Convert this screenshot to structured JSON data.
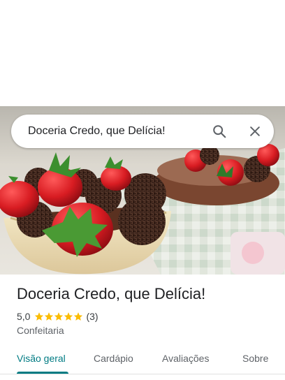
{
  "search": {
    "query": "Doceria Credo, que Delícia!",
    "search_icon": "search-icon",
    "clear_icon": "close-icon"
  },
  "place": {
    "name": "Doceria Credo, que Delícia!",
    "rating": "5,0",
    "rating_value": 5,
    "review_count": "(3)",
    "category": "Confeitaria",
    "star_color": "#fbbc04"
  },
  "tabs": [
    {
      "label": "Visão geral",
      "active": true
    },
    {
      "label": "Cardápio",
      "active": false
    },
    {
      "label": "Avaliações",
      "active": false
    },
    {
      "label": "Sobre",
      "active": false
    }
  ],
  "colors": {
    "accent": "#007b83",
    "title": "#202124",
    "secondary": "#5f6368"
  }
}
